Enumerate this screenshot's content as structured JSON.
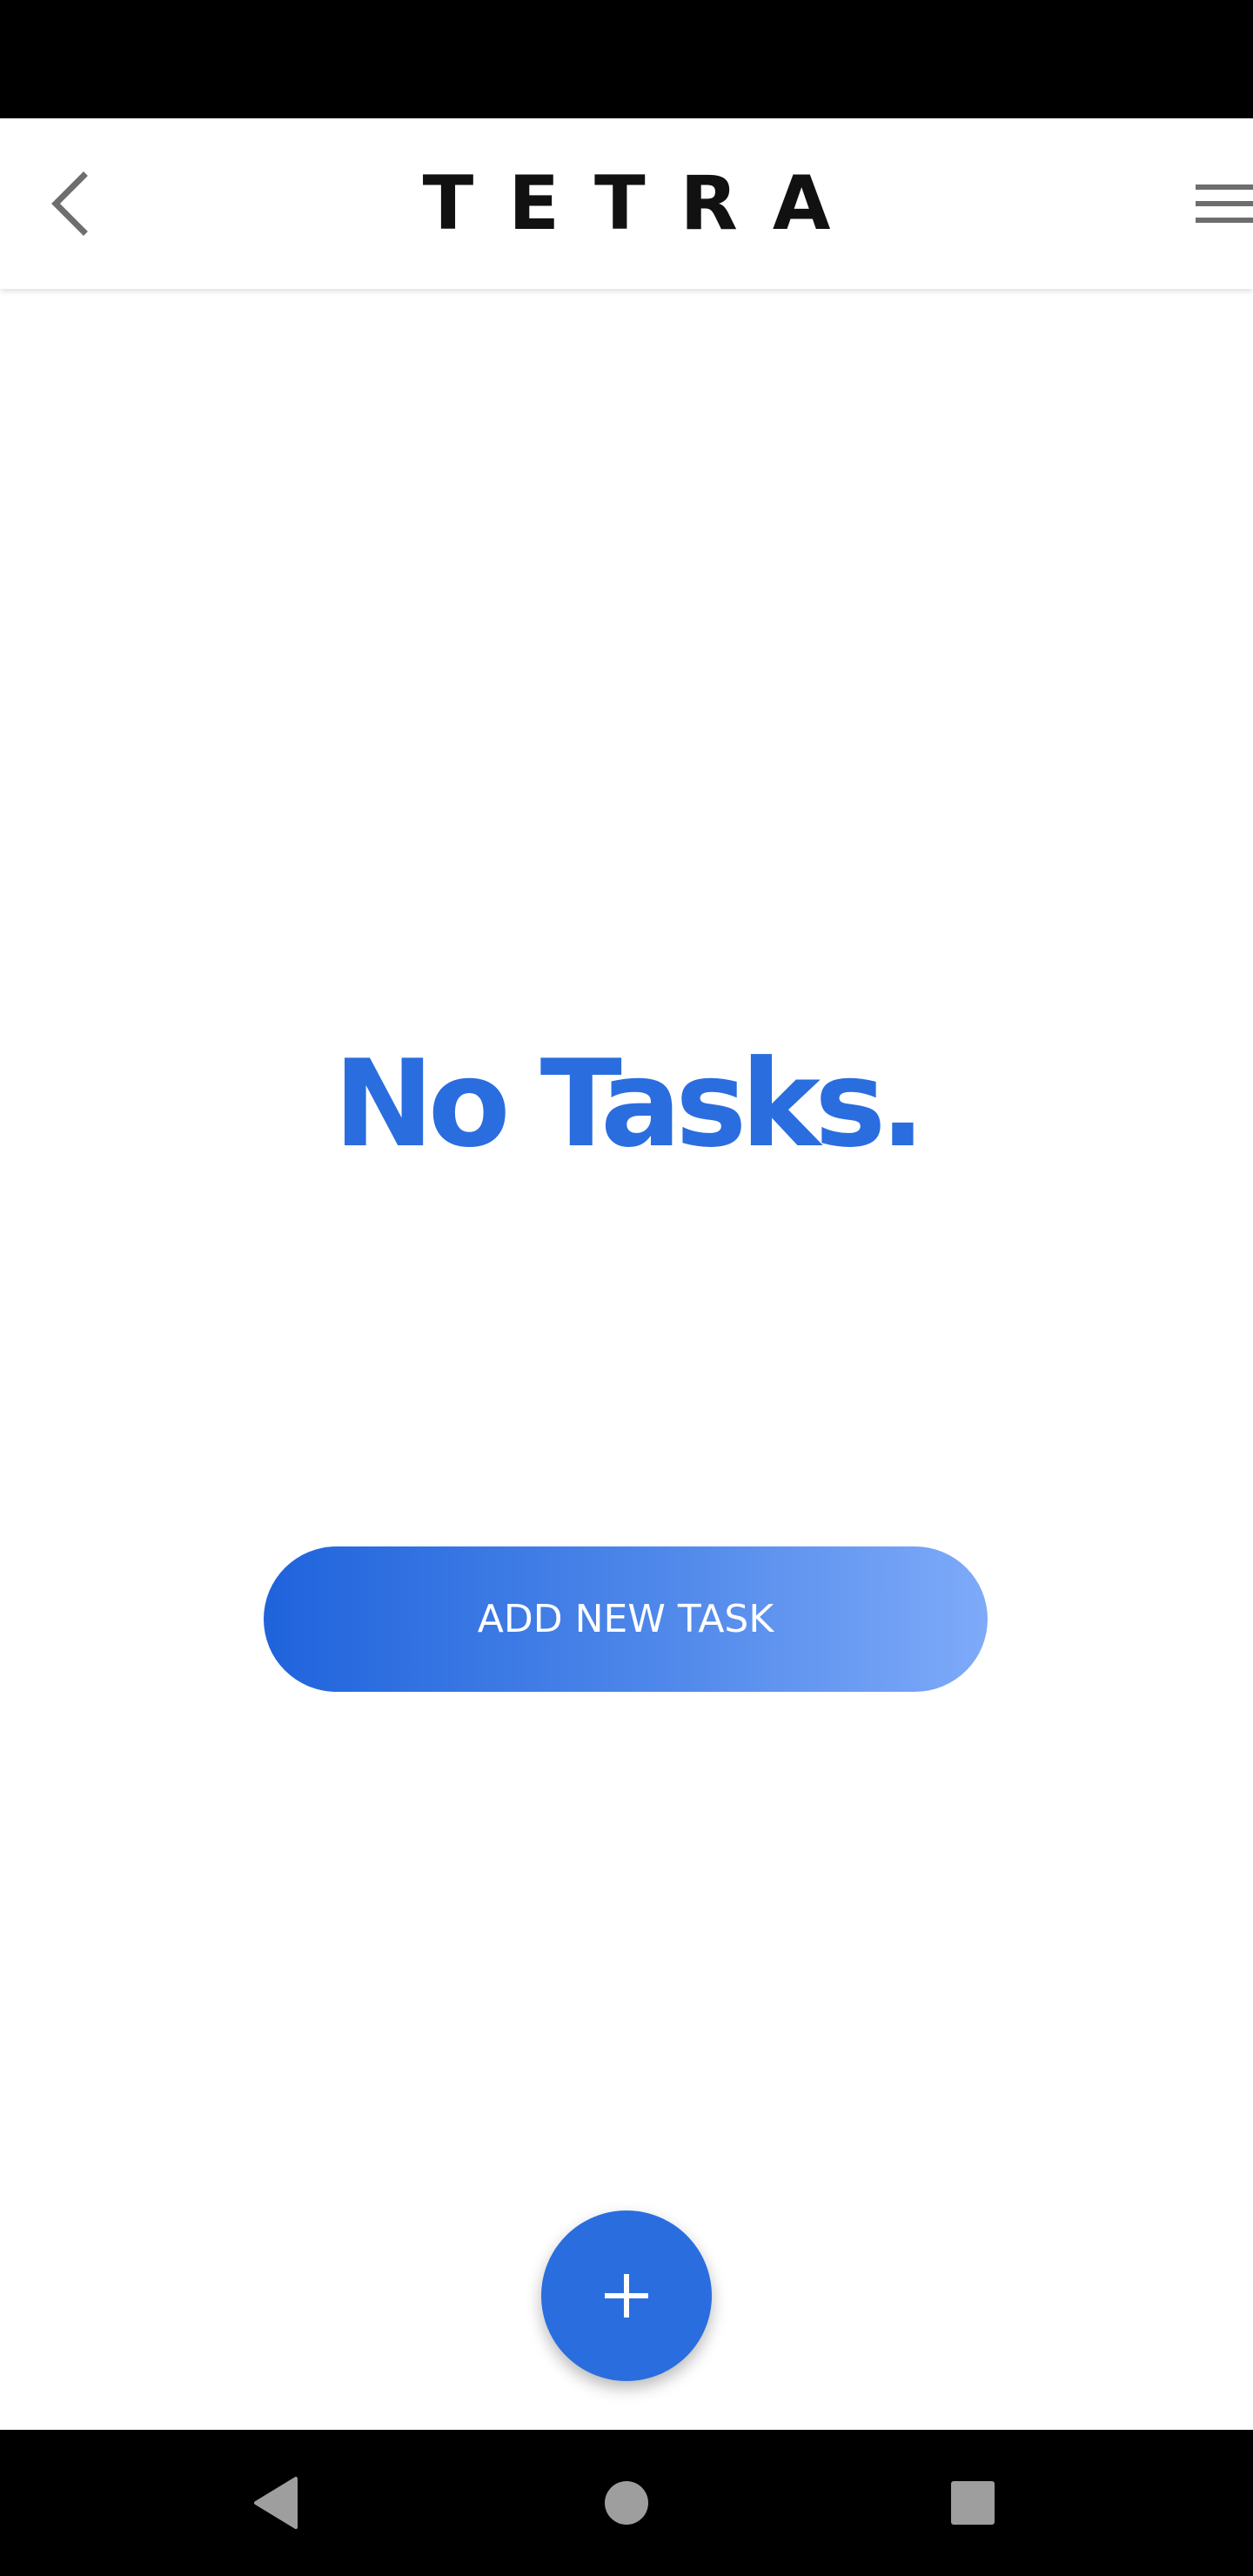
{
  "app_bar": {
    "title": "TETRA",
    "back_icon": "chevron-left-icon",
    "menu_icon": "hamburger-menu-icon"
  },
  "main": {
    "empty_message": "No Tasks.",
    "add_task_label": "ADD NEW TASK"
  },
  "fab": {
    "icon": "plus-icon"
  },
  "system_nav": {
    "back_icon": "triangle-back-icon",
    "home_icon": "circle-home-icon",
    "recents_icon": "square-recents-icon"
  },
  "colors": {
    "accent": "#2a6ddf",
    "gradient_start": "#1f63dc",
    "gradient_end": "#7eaaf9",
    "bars": "#000000",
    "icon_gray": "#6e6e6e"
  }
}
